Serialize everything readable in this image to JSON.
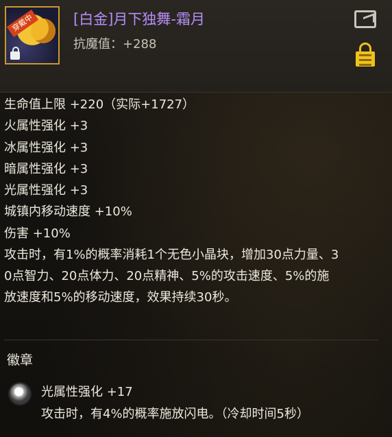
{
  "header": {
    "item_name": "[白金]月下独舞-霜月",
    "anti_magic": "抗魔值：+288",
    "icon_badge_text": "穿戴中",
    "title_color": "#b58ef8",
    "lock_color": "#f1c21c"
  },
  "stats": [
    "生命值上限 +220（实际+1727）",
    "火属性强化 +3",
    "冰属性强化 +3",
    "暗属性强化 +3",
    "光属性强化 +3",
    "城镇内移动速度 +10%",
    "伤害 +10%"
  ],
  "description_lines": [
    "攻击时，有1%的概率消耗1个无色小晶块，增加30点力量、3",
    "0点智力、20点体力、20点精神、5%的攻击速度、5%的施",
    "放速度和5%的移动速度，效果持续30秒。"
  ],
  "emblem_section": {
    "title": "徽章",
    "emblem_name": "光属性强化 +17",
    "emblem_desc": "攻击时，有4%的概率施放闪电。（冷却时间5秒）"
  },
  "icons": {
    "share": "share-icon",
    "lock": "lock-icon",
    "emblem": "emblem-gem-icon"
  }
}
